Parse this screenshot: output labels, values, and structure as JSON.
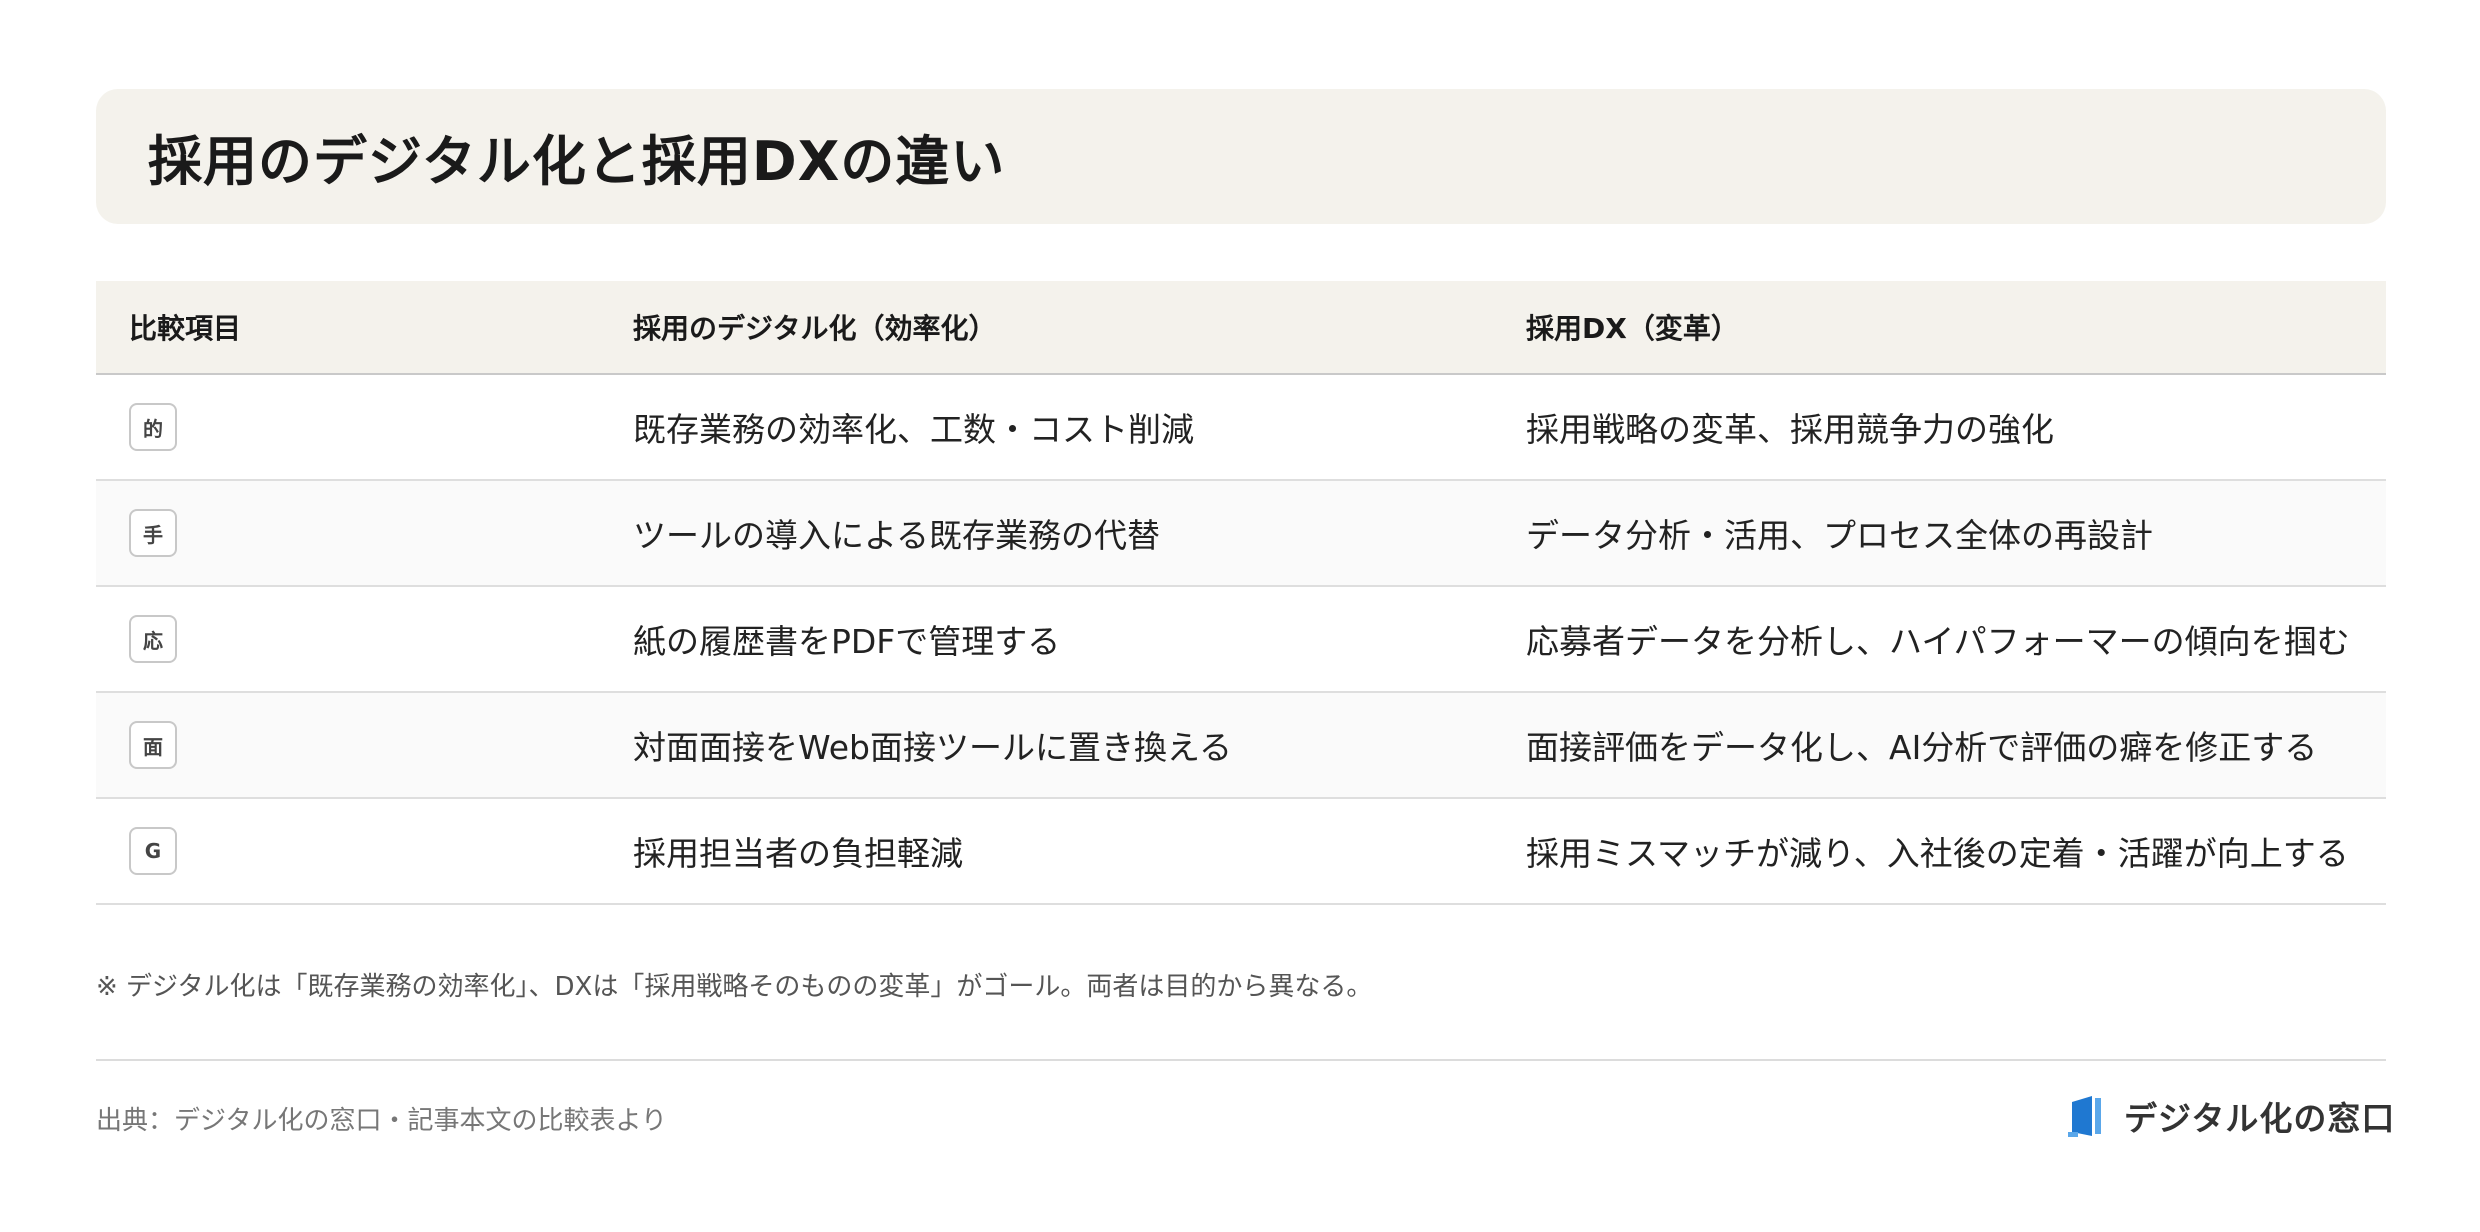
{
  "title": "採用のデジタル化と採用DXの違い",
  "table": {
    "headers": [
      "比較項目",
      "採用のデジタル化（効率化）",
      "採用DX（変革）"
    ],
    "rows": [
      {
        "badge": "的",
        "digital": "既存業務の効率化、工数・コスト削減",
        "dx": "採用戦略の変革、採用競争力の強化"
      },
      {
        "badge": "手",
        "digital": "ツールの導入による既存業務の代替",
        "dx": "データ分析・活用、プロセス全体の再設計"
      },
      {
        "badge": "応",
        "digital": "紙の履歴書をPDFで管理する",
        "dx": "応募者データを分析し、ハイパフォーマーの傾向を掴む"
      },
      {
        "badge": "面",
        "digital": "対面面接をWeb面接ツールに置き換える",
        "dx": "面接評価をデータ化し、AI分析で評価の癖を修正する"
      },
      {
        "badge": "G",
        "digital": "採用担当者の負担軽減",
        "dx": "採用ミスマッチが減り、入社後の定着・活躍が向上する"
      }
    ]
  },
  "note": "※ デジタル化は「既存業務の効率化」、DXは「採用戦略そのものの変革」がゴール。両者は目的から異なる。",
  "source": "出典：デジタル化の窓口・記事本文の比較表より",
  "logo": {
    "text": "デジタル化の窓口",
    "icon": "book-door-icon",
    "color_primary": "#1f78d1",
    "color_secondary": "#5aa7ea"
  },
  "colors": {
    "header_bg": "#f4f2ec",
    "row_alt_bg": "#fafafa"
  }
}
